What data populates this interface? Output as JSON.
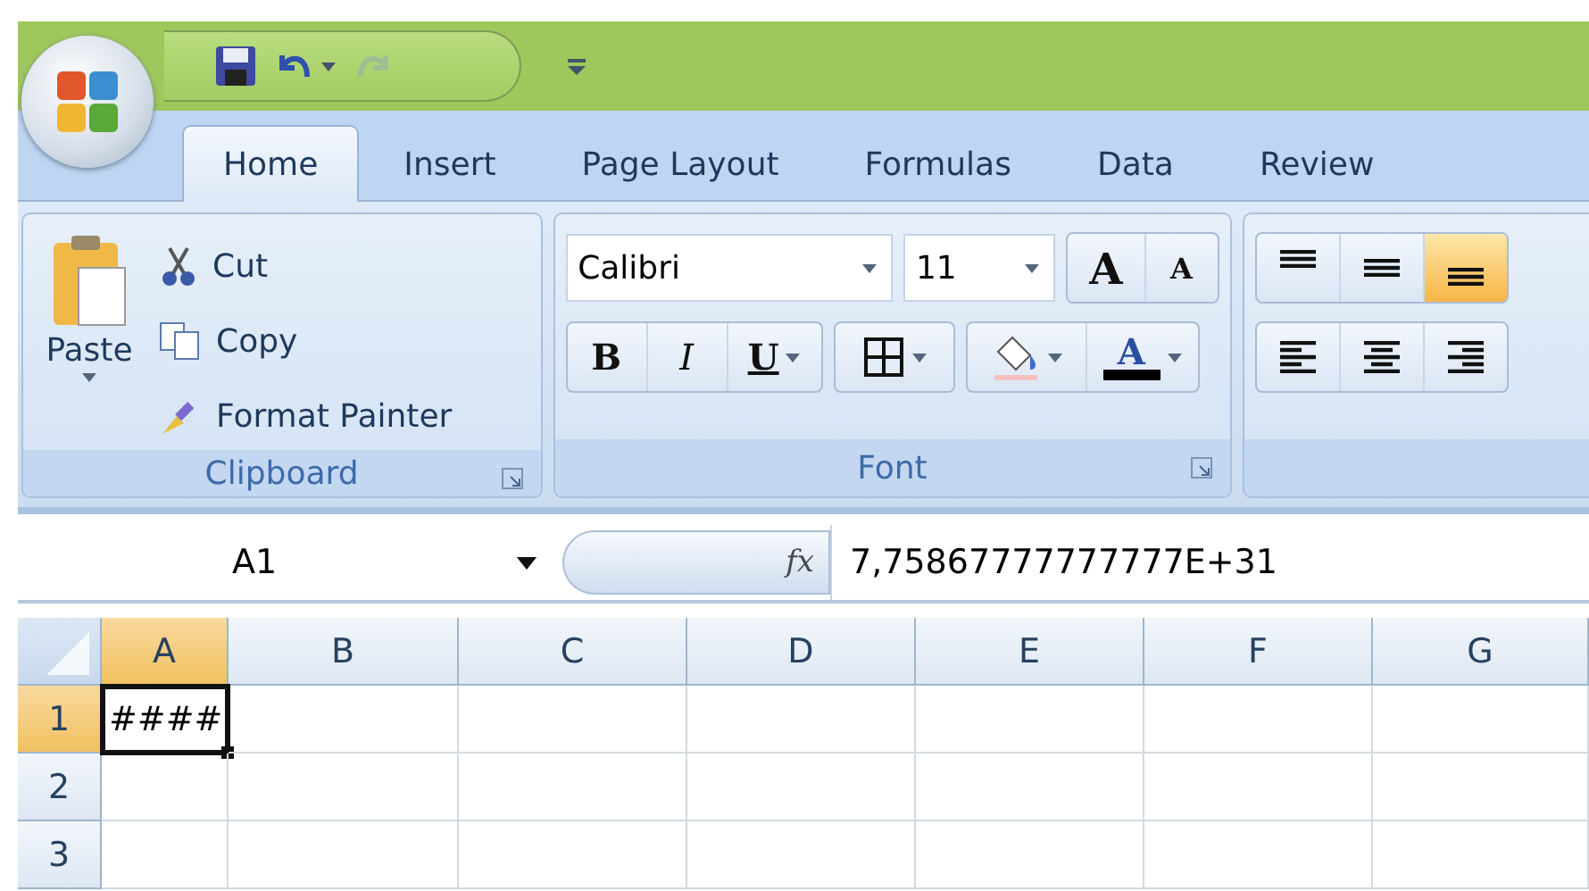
{
  "quick_access": {
    "redo_disabled": true
  },
  "tabs": [
    {
      "label": "Home",
      "selected": true
    },
    {
      "label": "Insert",
      "selected": false
    },
    {
      "label": "Page Layout",
      "selected": false
    },
    {
      "label": "Formulas",
      "selected": false
    },
    {
      "label": "Data",
      "selected": false
    },
    {
      "label": "Review",
      "selected": false
    }
  ],
  "clipboard": {
    "paste": "Paste",
    "cut": "Cut",
    "copy": "Copy",
    "format_painter": "Format Painter",
    "label": "Clipboard"
  },
  "font": {
    "name": "Calibri",
    "size": "11",
    "label": "Font",
    "format_buttons": [
      {
        "kind": "bold",
        "label": "B"
      },
      {
        "kind": "italic",
        "label": "I"
      },
      {
        "kind": "underline",
        "label": "U"
      }
    ],
    "grow": "A",
    "shrink": "A",
    "font_color": "A",
    "color": "#000000"
  },
  "alignment": {
    "vertical": [
      {
        "kind": "top",
        "selected": false
      },
      {
        "kind": "middle",
        "selected": false
      },
      {
        "kind": "bottom",
        "selected": true
      }
    ],
    "horizontal": [
      {
        "kind": "left",
        "selected": false
      },
      {
        "kind": "center",
        "selected": false
      },
      {
        "kind": "right",
        "selected": false
      }
    ]
  },
  "formula_bar": {
    "name_box": "A1",
    "fx": "fx",
    "value": "7,75867777777777E+31"
  },
  "sheet": {
    "columns": [
      {
        "label": "A",
        "selected": true
      },
      {
        "label": "B",
        "selected": false
      },
      {
        "label": "C",
        "selected": false
      },
      {
        "label": "D",
        "selected": false
      },
      {
        "label": "E",
        "selected": false
      },
      {
        "label": "F",
        "selected": false
      },
      {
        "label": "G",
        "selected": false
      }
    ],
    "rows": [
      {
        "label": "1",
        "selected": true,
        "cells": [
          {
            "text": "####",
            "active": true
          },
          {
            "active": false
          },
          {
            "active": false
          },
          {
            "active": false
          },
          {
            "active": false
          },
          {
            "active": false
          },
          {
            "active": false
          }
        ]
      },
      {
        "label": "2",
        "selected": false,
        "cells": [
          {
            "active": false
          },
          {
            "active": false
          },
          {
            "active": false
          },
          {
            "active": false
          },
          {
            "active": false
          },
          {
            "active": false
          },
          {
            "active": false
          }
        ]
      },
      {
        "label": "3",
        "selected": false,
        "cells": [
          {
            "active": false
          },
          {
            "active": false
          },
          {
            "active": false
          },
          {
            "active": false
          },
          {
            "active": false
          },
          {
            "active": false
          },
          {
            "active": false
          }
        ]
      }
    ]
  }
}
